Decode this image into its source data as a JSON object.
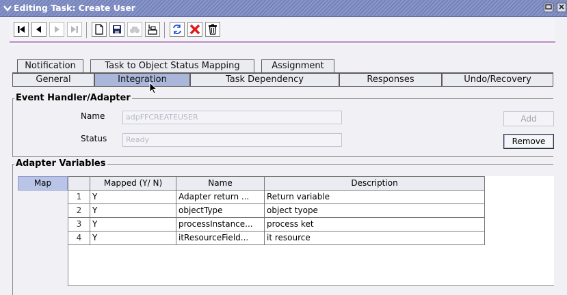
{
  "window": {
    "title": "Editing Task: Create User",
    "controls": [
      "minimize-icon",
      "close-icon"
    ]
  },
  "toolbar": {
    "buttons": [
      {
        "name": "first-record-icon",
        "enabled": true
      },
      {
        "name": "previous-record-icon",
        "enabled": true
      },
      {
        "name": "next-record-icon",
        "enabled": false
      },
      {
        "name": "last-record-icon",
        "enabled": false
      },
      {
        "name": "new-document-icon",
        "enabled": true
      },
      {
        "name": "save-icon",
        "enabled": true
      },
      {
        "name": "find-icon",
        "enabled": false
      },
      {
        "name": "query-icon",
        "enabled": true
      },
      {
        "name": "refresh-icon",
        "enabled": true
      },
      {
        "name": "delete-icon",
        "enabled": true
      },
      {
        "name": "trash-icon",
        "enabled": true
      }
    ]
  },
  "tabs": {
    "row1": [
      "Notification",
      "Task to Object Status Mapping",
      "Assignment"
    ],
    "row2": [
      "General",
      "Integration",
      "Task Dependency",
      "Responses",
      "Undo/Recovery"
    ],
    "active": "Integration"
  },
  "event_handler": {
    "group_title": "Event Handler/Adapter",
    "name_label": "Name",
    "name_value": "adpFFCREATEUSER",
    "status_label": "Status",
    "status_value": "Ready",
    "add_label": "Add",
    "remove_label": "Remove"
  },
  "adapter_variables": {
    "group_title": "Adapter Variables",
    "map_label": "Map",
    "columns": [
      "Mapped (Y/ N)",
      "Name",
      "Description"
    ],
    "rows": [
      {
        "num": "1",
        "mapped": "Y",
        "name": "Adapter return ...",
        "description": "Return variable"
      },
      {
        "num": "2",
        "mapped": "Y",
        "name": "objectType",
        "description": "object tyope"
      },
      {
        "num": "3",
        "mapped": "Y",
        "name": "processInstance...",
        "description": "process ket"
      },
      {
        "num": "4",
        "mapped": "Y",
        "name": "itResourceField...",
        "description": "it resource"
      }
    ]
  },
  "colors": {
    "title_bar": "#7f8cc2",
    "active_tab": "#aab7da",
    "toolbar_accent": "#c8a6cf",
    "delete_red": "#e01818"
  }
}
